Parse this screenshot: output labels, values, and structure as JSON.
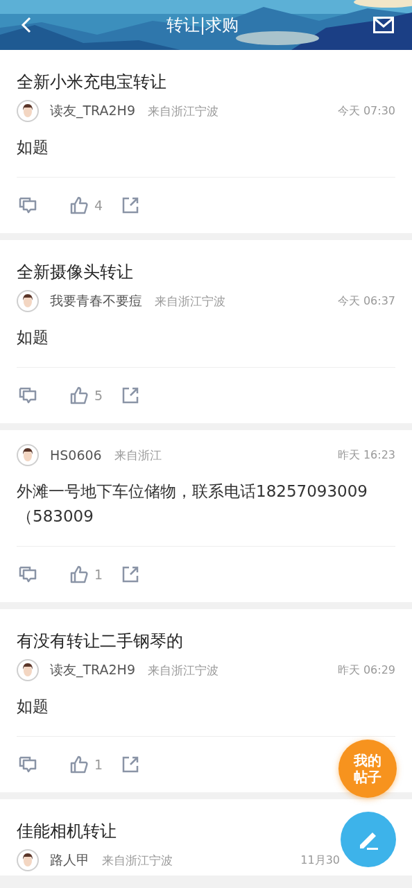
{
  "header": {
    "title": "转让|求购"
  },
  "posts": [
    {
      "title": "全新小米充电宝转让",
      "author": "读友_TRA2H9",
      "location": "来自浙江宁波",
      "time": "今天 07:30",
      "body": "如题",
      "likes": "4"
    },
    {
      "title": "全新摄像头转让",
      "author": "我要青春不要痘",
      "location": "来自浙江宁波",
      "time": "今天 06:37",
      "body": "如题",
      "likes": "5"
    },
    {
      "author": "HS0606",
      "location": "来自浙江",
      "time": "昨天 16:23",
      "body": "外滩一号地下车位储物，联系电话18257093009（583009",
      "likes": "1"
    },
    {
      "title": "有没有转让二手钢琴的",
      "author": "读友_TRA2H9",
      "location": "来自浙江宁波",
      "time": "昨天 06:29",
      "body": "如题",
      "likes": "1"
    },
    {
      "title": "佳能相机转让",
      "author": "路人甲",
      "location": "来自浙江宁波",
      "time": "11月30",
      "time_covered": true
    }
  ],
  "my_posts_button": {
    "label": "我的帖子"
  }
}
